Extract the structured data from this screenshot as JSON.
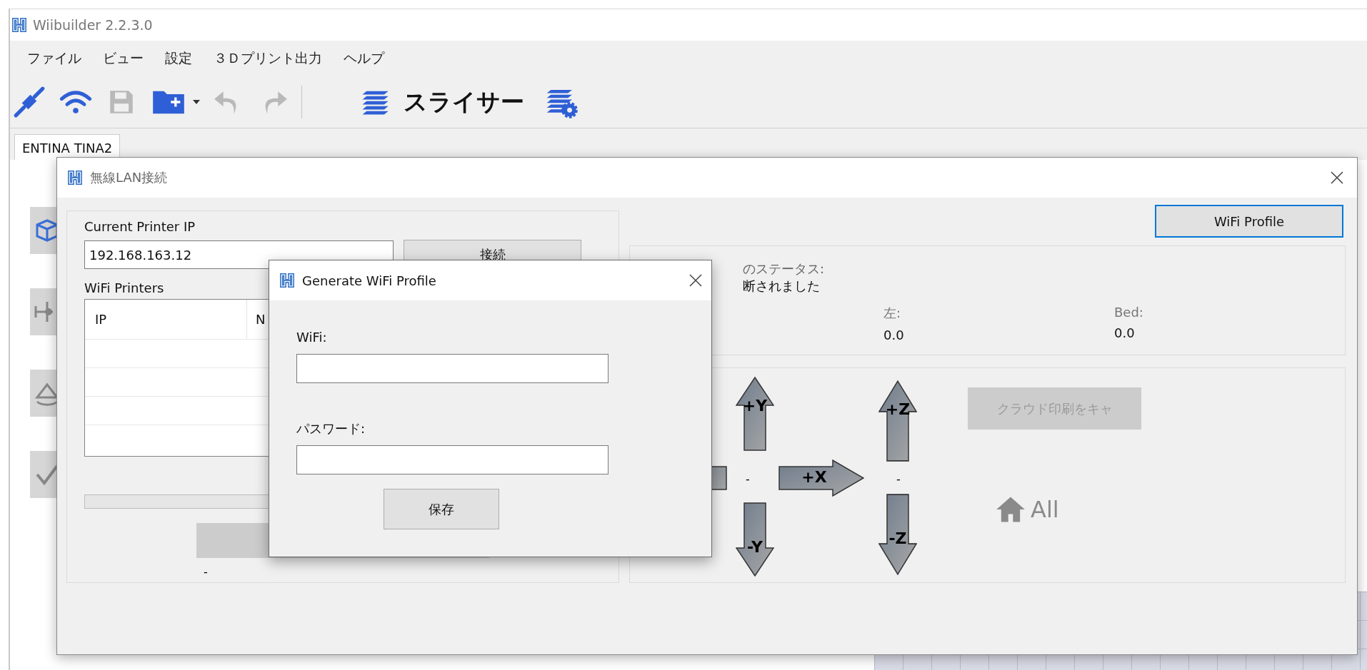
{
  "app": {
    "title": "Wiibuilder 2.2.3.0"
  },
  "menu": [
    "ファイル",
    "ビュー",
    "設定",
    "３Ｄプリント出力",
    "ヘルプ"
  ],
  "toolbar": [
    {
      "kind": "plug",
      "disabled": false
    },
    {
      "kind": "wifi",
      "disabled": false
    },
    {
      "kind": "save",
      "disabled": true
    },
    {
      "kind": "folder",
      "disabled": false
    },
    {
      "kind": "dropdown",
      "disabled": false
    },
    {
      "kind": "undo",
      "disabled": true
    },
    {
      "kind": "redo",
      "disabled": true
    },
    {
      "kind": "separator"
    },
    {
      "kind": "slicer",
      "label": "スライサー",
      "disabled": false
    },
    {
      "kind": "slicer-settings",
      "disabled": false
    }
  ],
  "tabs": [
    {
      "label": "ENTINA TINA2",
      "selected": true
    }
  ],
  "sidebar": [
    {
      "kind": "cube"
    },
    {
      "kind": "move"
    },
    {
      "kind": "rotate"
    },
    {
      "kind": "check"
    }
  ],
  "wlan_dialog": {
    "title": "無線LAN接続",
    "current_ip_label": "Current Printer IP",
    "ip_value": "192.168.163.12",
    "connect_button": "接続",
    "printers_label": "WiFi Printers",
    "columns": [
      "IP",
      "N"
    ],
    "progress": {
      "level": 0
    },
    "footer_text": "-",
    "profile_button": "WiFi Profile",
    "status_label": "のステータス:",
    "status_value": "断されました",
    "temps": [
      {
        "label": "左:",
        "value": "0.0"
      },
      {
        "label": "Bed:",
        "value": "0.0"
      }
    ],
    "jog": [
      {
        "kind": "left"
      },
      {
        "kind": "up",
        "label": "+Y"
      },
      {
        "kind": "down",
        "label": "-Y"
      },
      {
        "kind": "right",
        "label": "+X"
      },
      {
        "kind": "up",
        "label": "+Z"
      },
      {
        "kind": "down",
        "label": "-Z"
      }
    ],
    "jog_dashes": [
      "-",
      "-"
    ],
    "cloud_button": {
      "label": "クラウド印刷をキャ",
      "disabled": true
    },
    "home_all": "All"
  },
  "profile_dialog": {
    "title": "Generate WiFi Profile",
    "fields": [
      {
        "label": "WiFi:"
      },
      {
        "label": "パスワード:"
      }
    ],
    "save_button": "保存"
  }
}
